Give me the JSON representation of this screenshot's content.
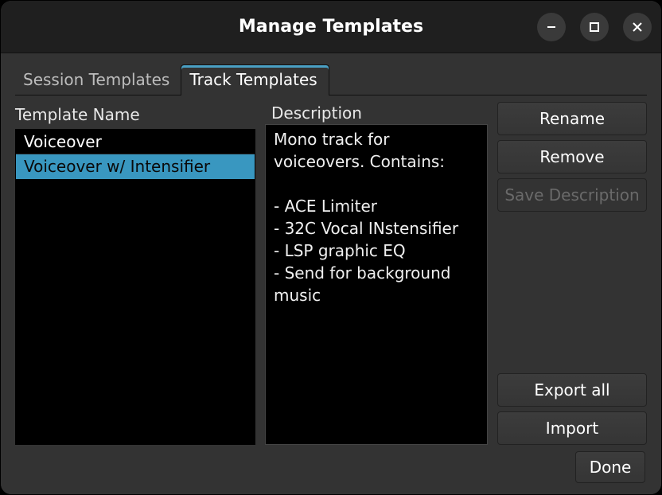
{
  "title": "Manage Templates",
  "tabs": [
    {
      "label": "Session Templates",
      "active": false
    },
    {
      "label": "Track Templates",
      "active": true
    }
  ],
  "columnHeader": "Template Name",
  "templates": [
    {
      "name": "Voiceover",
      "selected": false
    },
    {
      "name": "Voiceover w/ Intensifier",
      "selected": true
    }
  ],
  "descriptionLabel": "Description",
  "descriptionText": "Mono track for voiceovers. Contains:\n\n- ACE Limiter\n- 32C Vocal INstensifier\n- LSP graphic EQ\n- Send for background music",
  "buttons": {
    "rename": "Rename",
    "remove": "Remove",
    "saveDescription": "Save Description",
    "exportAll": "Export all",
    "import": "Import",
    "done": "Done"
  },
  "buttonStates": {
    "saveDescriptionEnabled": false
  }
}
